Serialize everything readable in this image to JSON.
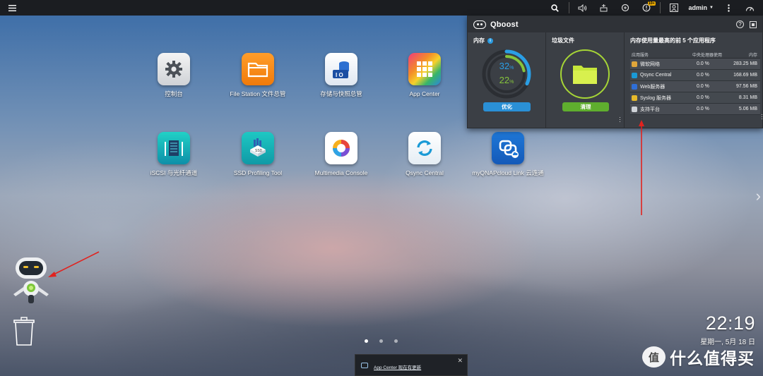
{
  "topbar": {
    "menu_icon": "hamburger-icon",
    "user": "admin",
    "notification_badge": "10+"
  },
  "desktop": {
    "apps_row1": [
      {
        "label": "控制台",
        "icon": "gear-icon"
      },
      {
        "label": "File Station 文件总管",
        "icon": "folder-icon"
      },
      {
        "label": "存储与快照总管",
        "icon": "storage-icon"
      },
      {
        "label": "App Center",
        "icon": "app-grid-icon"
      }
    ],
    "apps_row2": [
      {
        "label": "iSCSI 与光纤通道",
        "icon": "iscsi-icon"
      },
      {
        "label": "SSD Profiling Tool",
        "icon": "ssd-icon"
      },
      {
        "label": "Multimedia Console",
        "icon": "multimedia-icon"
      },
      {
        "label": "Qsync Central",
        "icon": "sync-icon"
      },
      {
        "label": "myQNAPcloud Link 云连通",
        "icon": "cloud-link-icon"
      }
    ]
  },
  "qboost": {
    "title": "Qboost",
    "memory": {
      "title": "内存",
      "cpu_percent": "32",
      "mem_percent": "22",
      "unit": "%",
      "optimize_label": "优化"
    },
    "junk": {
      "title": "垃圾文件",
      "clean_label": "清理"
    },
    "top_apps": {
      "title": "内存使用量最高的前 5 个应用程序",
      "col_app": "应用服务",
      "col_cpu": "中央处理器使用",
      "col_mem": "内存",
      "rows": [
        {
          "name": "微软网络",
          "cpu": "0.0 %",
          "mem": "283.25 MB"
        },
        {
          "name": "Qsync Central",
          "cpu": "0.0 %",
          "mem": "168.69 MB"
        },
        {
          "name": "Web服务器",
          "cpu": "0.0 %",
          "mem": "97.56 MB"
        },
        {
          "name": "Syslog 服务器",
          "cpu": "0.0 %",
          "mem": "8.31 MB"
        },
        {
          "name": "支持平台",
          "cpu": "0.0 %",
          "mem": "5.06 MB"
        }
      ]
    }
  },
  "clock": {
    "time": "22:19",
    "date": "星期一, 5月 18 日"
  },
  "notification": {
    "text": "App Center 现在有更新"
  },
  "watermark": {
    "logo": "值",
    "text": "什么值得买"
  },
  "colors": {
    "cpu": "#2a9fe6",
    "memory": "#86c53c",
    "annotation": "#e1231f"
  }
}
